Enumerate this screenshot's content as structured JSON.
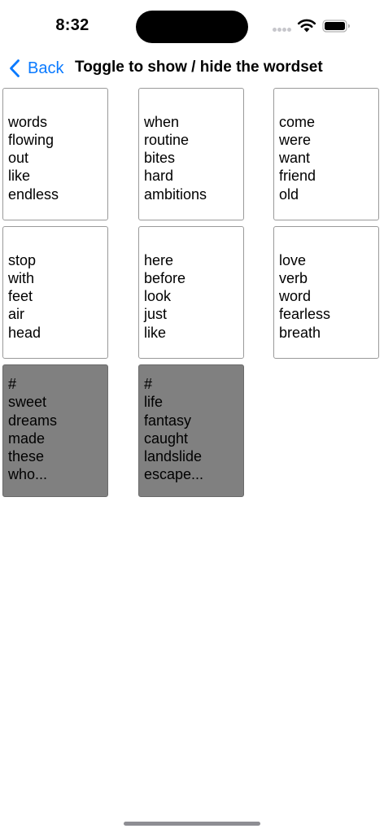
{
  "status_bar": {
    "time": "8:32"
  },
  "nav": {
    "back_label": "Back",
    "title": "Toggle to show / hide the wordset"
  },
  "colors": {
    "accent": "#0a7aff",
    "hidden_card_bg": "#808080"
  },
  "cards": [
    {
      "state": "shown",
      "words": [
        "words",
        "flowing",
        "out",
        "like",
        "endless"
      ]
    },
    {
      "state": "shown",
      "words": [
        "when",
        "routine",
        "bites",
        "hard",
        "ambitions"
      ]
    },
    {
      "state": "shown",
      "words": [
        "come",
        "were",
        "want",
        "friend",
        "old"
      ]
    },
    {
      "state": "shown",
      "words": [
        "stop",
        "with",
        "feet",
        "air",
        "head"
      ]
    },
    {
      "state": "shown",
      "words": [
        "here",
        "before",
        "look",
        "just",
        "like"
      ]
    },
    {
      "state": "shown",
      "words": [
        "love",
        "verb",
        "word",
        "fearless",
        "breath"
      ]
    },
    {
      "state": "hidden",
      "words": [
        "#",
        "sweet",
        "dreams",
        "made",
        "these",
        "who..."
      ]
    },
    {
      "state": "hidden",
      "words": [
        "#",
        "life",
        "fantasy",
        "caught",
        "landslide",
        "escape..."
      ]
    }
  ]
}
